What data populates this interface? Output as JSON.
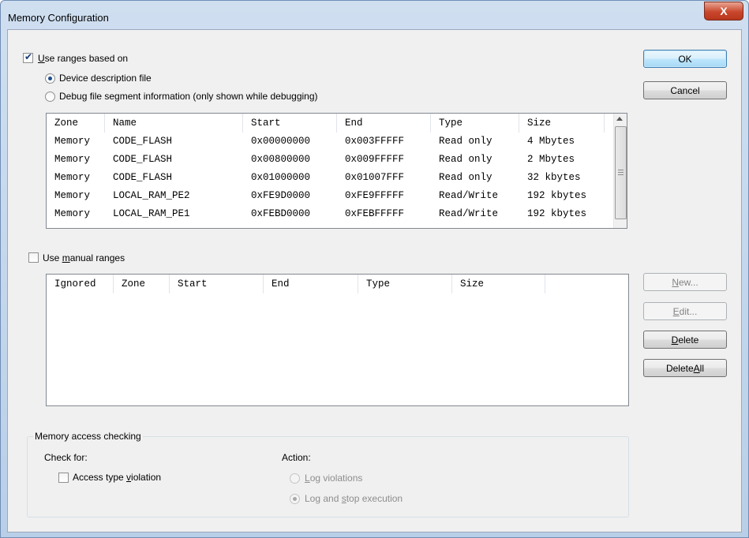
{
  "window": {
    "title": "Memory Configuration",
    "close_label": "X"
  },
  "ranges": {
    "use_ranges": {
      "checked": true,
      "label_key": "U",
      "label_rest": "se ranges based on"
    },
    "options": [
      {
        "label": "Device description file",
        "selected": true
      },
      {
        "label": "Debug file segment information  (only shown while debugging)",
        "selected": false
      }
    ],
    "columns": [
      "Zone",
      "Name",
      "Start",
      "End",
      "Type",
      "Size"
    ],
    "rows": [
      [
        "Memory",
        "CODE_FLASH",
        "0x00000000",
        "0x003FFFFF",
        "Read only",
        "4 Mbytes"
      ],
      [
        "Memory",
        "CODE_FLASH",
        "0x00800000",
        "0x009FFFFF",
        "Read only",
        "2 Mbytes"
      ],
      [
        "Memory",
        "CODE_FLASH",
        "0x01000000",
        "0x01007FFF",
        "Read only",
        "32 kbytes"
      ],
      [
        "Memory",
        "LOCAL_RAM_PE2",
        "0xFE9D0000",
        "0xFE9FFFFF",
        "Read/Write",
        "192 kbytes"
      ],
      [
        "Memory",
        "LOCAL_RAM_PE1",
        "0xFEBD0000",
        "0xFEBFFFFF",
        "Read/Write",
        "192 kbytes"
      ]
    ]
  },
  "manual": {
    "use_manual": {
      "checked": false,
      "label_pre": "Use ",
      "label_key": "m",
      "label_rest": "anual ranges"
    },
    "columns": [
      "Ignored",
      "Zone",
      "Start",
      "End",
      "Type",
      "Size"
    ]
  },
  "buttons": {
    "ok": "OK",
    "cancel": "Cancel",
    "new_key": "N",
    "new_rest": "ew...",
    "edit_key": "E",
    "edit_rest": "dit...",
    "delete_key": "D",
    "delete_rest": "elete",
    "delete_all_pre": "Delete ",
    "delete_all_key": "A",
    "delete_all_rest": "ll"
  },
  "access_checking": {
    "group_title": "Memory access checking",
    "check_for_label": "Check for:",
    "action_label": "Action:",
    "access_violation": {
      "checked": false,
      "label_pre": "Access type ",
      "label_key": "v",
      "label_rest": "iolation"
    },
    "actions": [
      {
        "label_key": "L",
        "label_rest": "og violations",
        "selected": false
      },
      {
        "label_pre": "Log and ",
        "label_key": "s",
        "label_rest": "top execution",
        "selected": true
      }
    ]
  },
  "colors": {
    "title_gradient_top": "#cfdff0",
    "client_bg": "#f0f0f0",
    "close_button": "#c9472c",
    "default_button_border": "#3c7fb1",
    "disabled_text": "#8d8d8d"
  },
  "icons": {
    "close": "close-icon",
    "scroll_up": "scroll-up-arrow-icon"
  }
}
